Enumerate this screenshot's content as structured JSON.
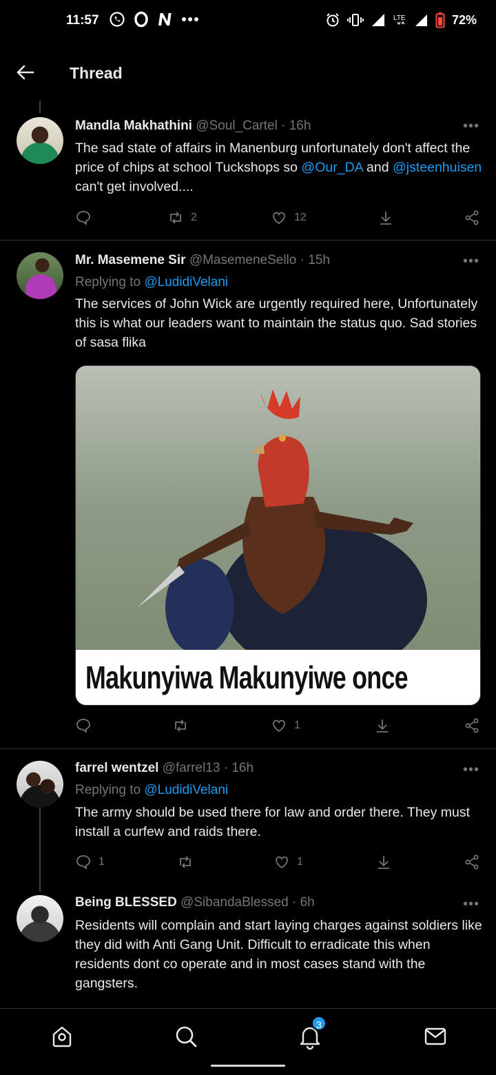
{
  "status_bar": {
    "time": "11:57",
    "left_icons": [
      "whatsapp-icon",
      "opera-icon",
      "netflix-icon",
      "more-icon"
    ],
    "right_icons": [
      "alarm-icon",
      "vibrate-icon",
      "signal-icon",
      "lte-icon",
      "signal-icon",
      "battery-icon"
    ],
    "battery": "72%",
    "network": "LTE"
  },
  "header": {
    "title": "Thread"
  },
  "tweets": [
    {
      "name": "Mandla Makhathini",
      "handle": "@Soul_Cartel",
      "time": "· 16h",
      "body_pre": "The sad state of affairs in Manenburg unfortunately don't affect the price of chips at school Tuckshops so ",
      "mention1": "@Our_DA",
      "body_mid": " and ",
      "mention2": "@jsteenhuisen",
      "body_post": " can't get involved....",
      "retweets": "2",
      "likes": "12"
    },
    {
      "name": "Mr. Masemene Sir",
      "handle": "@MasemeneSello",
      "time": "· 15h",
      "replying_to": "Replying to ",
      "replying_mention": "@LudidiVelani",
      "body": "The services of John Wick are urgently required here, Unfortunately this is what our leaders want to maintain the status quo. Sad stories of sasa flika",
      "media_caption": "Makunyiwa Makunyiwe once",
      "likes": "1"
    },
    {
      "name": "farrel wentzel",
      "handle": "@farrel13",
      "time": "· 16h",
      "replying_to": "Replying to ",
      "replying_mention": "@LudidiVelani",
      "body": "The army should be used there for law and order there. They must install a curfew and raids there.",
      "replies": "1",
      "likes": "1"
    },
    {
      "name": "Being BLESSED",
      "handle": "@SibandaBlessed",
      "time": "· 6h",
      "body": "Residents will complain and start laying  charges against soldiers like they did with Anti Gang Unit. Difficult to erradicate this when residents dont co operate and in most cases stand with the gangsters."
    }
  ],
  "bottom_nav": {
    "items": [
      "home-icon",
      "search-icon",
      "notifications-icon",
      "messages-icon"
    ],
    "notification_count": "3"
  }
}
